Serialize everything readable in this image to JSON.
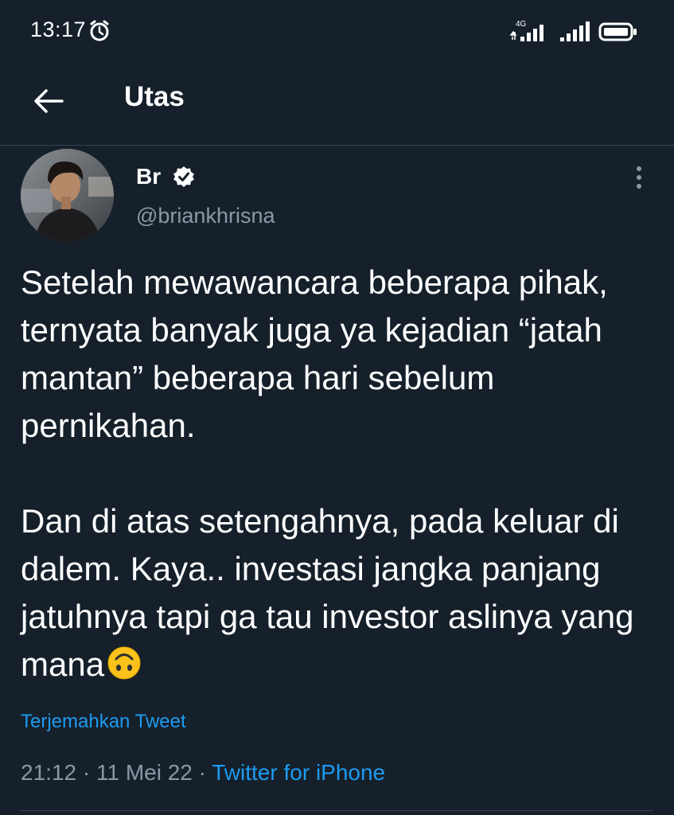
{
  "status_bar": {
    "time": "13:17",
    "network_label": "4G",
    "alarm_icon": "alarm-clock-icon",
    "battery_icon": "battery-icon"
  },
  "header": {
    "title": "Utas",
    "back_icon": "arrow-left-icon"
  },
  "tweet": {
    "display_name": "Br",
    "verified": true,
    "handle": "@briankhrisna",
    "paragraphs": [
      "Setelah mewawancara beberapa pihak, ternyata banyak juga ya kejadian “jatah mantan” beberapa hari sebelum pernikahan.",
      "Dan di atas setengahnya, pada keluar di dalem. Kaya.. investasi jangka panjang jatuhnya tapi ga tau investor aslinya yang mana"
    ],
    "emoji": "upside-down-face-emoji",
    "translate_label": "Terjemahkan Tweet",
    "time": "21:12",
    "separator": "·",
    "date": "11 Mei 22",
    "source": "Twitter for iPhone"
  },
  "colors": {
    "background": "#15202b",
    "text_primary": "#ffffff",
    "text_secondary": "#8b98a5",
    "link": "#1d9bf0",
    "divider": "#38444d"
  }
}
